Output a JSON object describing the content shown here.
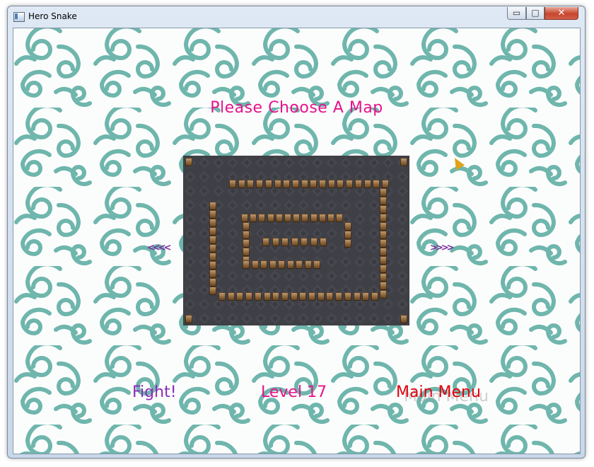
{
  "window": {
    "title": "Hero Snake",
    "minimize_glyph": "▭",
    "maximize_glyph": "□",
    "close_glyph": "✕"
  },
  "game": {
    "heading": "Please Choose A Map",
    "prev_arrow": "<<<<",
    "next_arrow": ">>>>",
    "fight_label": "Fight!",
    "level_label": "Level 17",
    "main_menu_label": "Main Menu",
    "main_menu_ghost": "Main Menu"
  },
  "colors": {
    "heading": "#e8128d",
    "fight": "#8a2ab6",
    "level": "#e8128d",
    "main_menu": "#e0000f",
    "arrows": "#7a2e9e",
    "swirl": "#6fb6ad",
    "map_floor": "#3f3f46"
  }
}
